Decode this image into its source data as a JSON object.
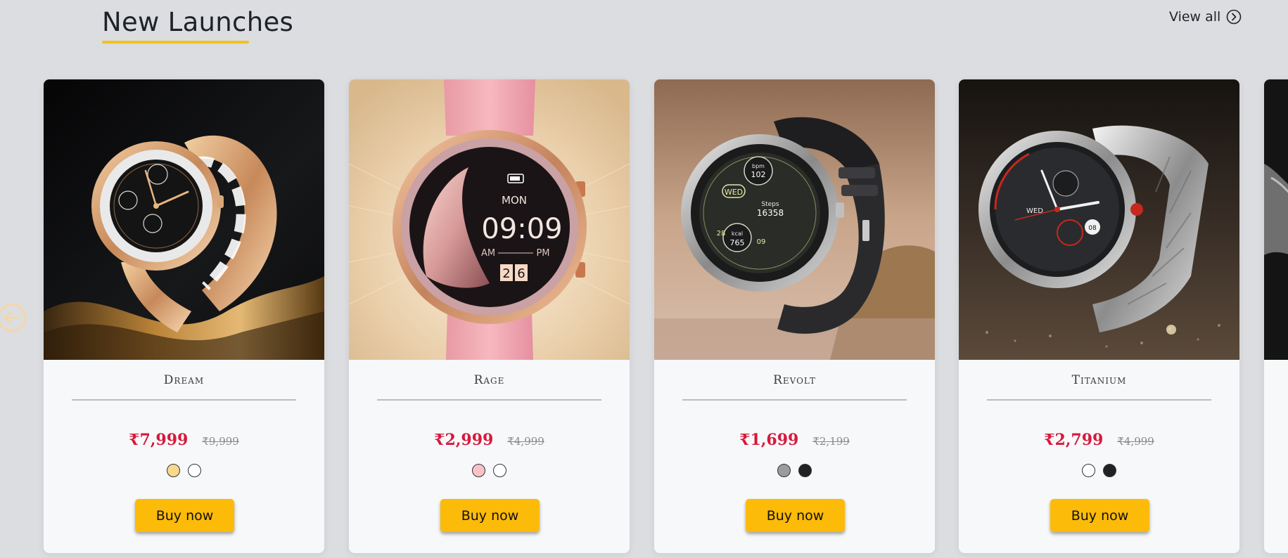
{
  "section": {
    "title": "New Launches",
    "view_all_label": "View all",
    "accent_color": "#f0c419"
  },
  "navigation": {
    "prev_icon": "arrow-left-circle-icon",
    "view_all_icon": "chevron-right-circle-icon"
  },
  "products": [
    {
      "name": "Dream",
      "price": "₹7,999",
      "mrp": "₹9,999",
      "swatches": [
        "#f7d98b",
        "#ffffff"
      ],
      "button_label": "Buy now",
      "watch": {
        "face_text": "",
        "image_theme": "rose-gold-on-black"
      }
    },
    {
      "name": "Rage",
      "price": "₹2,999",
      "mrp": "₹4,999",
      "swatches": [
        "#f7c3c8",
        "#ffffff"
      ],
      "button_label": "Buy now",
      "watch": {
        "day": "MON",
        "time": "09:09",
        "am": "AM",
        "pm": "PM",
        "date_1": "2",
        "date_2": "6",
        "image_theme": "pink-strap-on-beige"
      }
    },
    {
      "name": "Revolt",
      "price": "₹1,699",
      "mrp": "₹2,199",
      "swatches": [
        "#9c9c9c",
        "#222222"
      ],
      "button_label": "Buy now",
      "watch": {
        "day": "WED",
        "bpm_label": "bpm",
        "bpm": "102",
        "steps_label": "Steps",
        "steps": "16358",
        "kcal_label": "kcal",
        "kcal": "765",
        "left_num": "28",
        "right_num": "09",
        "image_theme": "black-strap-on-brown"
      }
    },
    {
      "name": "Titanium",
      "price": "₹2,799",
      "mrp": "₹4,999",
      "swatches": [
        "#ffffff",
        "#222222"
      ],
      "button_label": "Buy now",
      "watch": {
        "day": "WED",
        "small": "08",
        "image_theme": "silver-on-dark"
      }
    }
  ],
  "colors": {
    "page_bg": "#dcdde0",
    "price": "#d7193b",
    "buy_button": "#fcbb08",
    "card_bg": "#f7f8fa"
  }
}
